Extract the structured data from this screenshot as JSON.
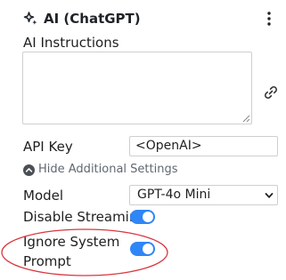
{
  "panel": {
    "title": "AI (ChatGPT)",
    "title_icon": "sparkle-icon",
    "menu_icon": "kebab-menu-icon"
  },
  "instructions": {
    "label": "AI Instructions",
    "value": "",
    "link_icon": "link-icon"
  },
  "api_key": {
    "label": "API Key",
    "value": "<OpenAI>"
  },
  "additional_settings": {
    "toggle_label": "Hide Additional Settings",
    "icon": "chevron-up-circle-icon"
  },
  "model": {
    "label": "Model",
    "selected": "GPT-4o Mini"
  },
  "disable_streaming": {
    "label": "Disable Streaming",
    "enabled": true
  },
  "ignore_system_prompt": {
    "label_line1": "Ignore System",
    "label_line2": "Prompt",
    "enabled": true
  },
  "colors": {
    "toggle_on": "#2f86f6",
    "highlight": "#d9363e",
    "border": "#cfcfcf"
  }
}
